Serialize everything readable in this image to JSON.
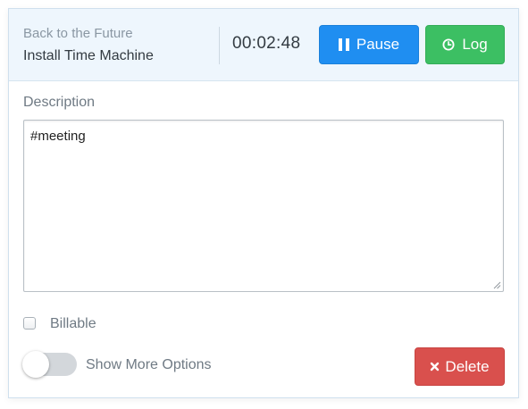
{
  "header": {
    "project": "Back to the Future",
    "task": "Install Time Machine",
    "timer": "00:02:48",
    "pause_label": "Pause",
    "log_label": "Log"
  },
  "description": {
    "label": "Description",
    "value": "#meeting"
  },
  "billable": {
    "label": "Billable",
    "checked": false
  },
  "more_options": {
    "label": "Show More Options",
    "enabled": false
  },
  "delete_label": "Delete",
  "colors": {
    "pause": "#1f8ef1",
    "log": "#3cbf63",
    "delete": "#d9504d",
    "header_bg": "#eef6fd"
  },
  "icons": {
    "pause": "pause-icon",
    "log": "clock-icon",
    "delete": "x-icon"
  }
}
